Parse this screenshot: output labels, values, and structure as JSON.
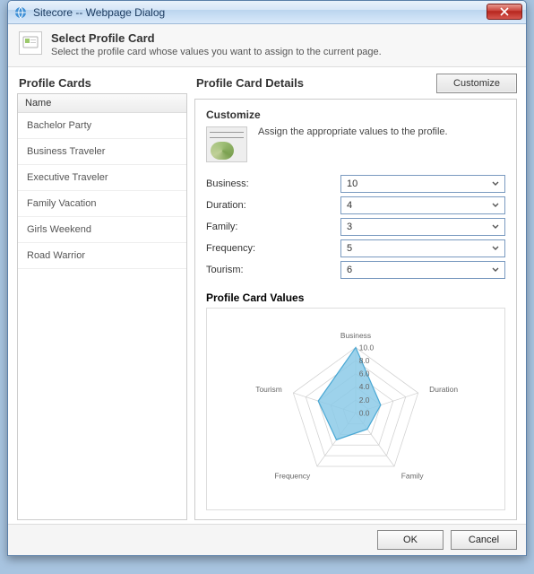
{
  "window": {
    "title": "Sitecore -- Webpage Dialog"
  },
  "header": {
    "title": "Select Profile Card",
    "subtitle": "Select the profile card whose values you want to assign to the current page."
  },
  "left": {
    "title": "Profile Cards",
    "name_col": "Name",
    "items": [
      {
        "label": "Bachelor Party"
      },
      {
        "label": "Business Traveler"
      },
      {
        "label": "Executive Traveler"
      },
      {
        "label": "Family Vacation"
      },
      {
        "label": "Girls Weekend"
      },
      {
        "label": "Road Warrior"
      }
    ]
  },
  "right": {
    "title": "Profile Card Details",
    "customize_btn": "Customize",
    "section_title": "Customize",
    "desc": "Assign the appropriate values to the profile.",
    "fields": [
      {
        "label": "Business:",
        "value": "10"
      },
      {
        "label": "Duration:",
        "value": "4"
      },
      {
        "label": "Family:",
        "value": "3"
      },
      {
        "label": "Frequency:",
        "value": "5"
      },
      {
        "label": "Tourism:",
        "value": "6"
      }
    ],
    "values_title": "Profile Card Values"
  },
  "footer": {
    "ok": "OK",
    "cancel": "Cancel"
  },
  "chart_data": {
    "type": "radar",
    "categories": [
      "Business",
      "Duration",
      "Family",
      "Frequency",
      "Tourism"
    ],
    "values": [
      10,
      4,
      3,
      5,
      6
    ],
    "ticks": [
      0,
      2,
      4,
      6,
      8,
      10
    ],
    "tick_labels": [
      "0.0",
      "2.0",
      "4.0",
      "6.0",
      "8.0",
      "10.0"
    ],
    "max": 10,
    "fill": "#8ccae8",
    "stroke": "#4aa8d4"
  }
}
